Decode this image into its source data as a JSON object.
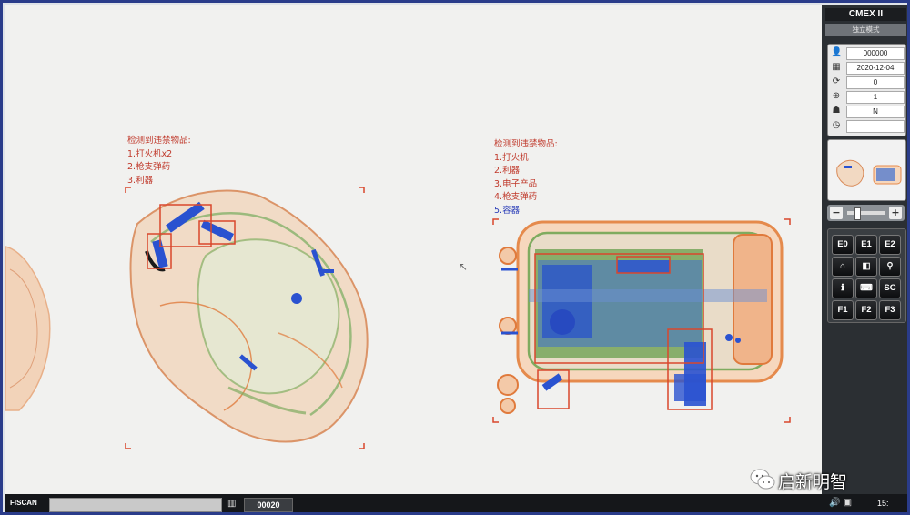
{
  "panel": {
    "brand": "CMEX II",
    "mode": "独立模式",
    "info": [
      {
        "icon": "user-icon",
        "value": "000000"
      },
      {
        "icon": "calendar-icon",
        "value": "2020-12-04"
      },
      {
        "icon": "counter-icon",
        "value": "0"
      },
      {
        "icon": "zoom-icon",
        "value": "1"
      },
      {
        "icon": "mode-icon",
        "value": "N"
      },
      {
        "icon": "clock-icon",
        "value": ""
      }
    ],
    "keys": [
      "E0",
      "E1",
      "E2",
      "",
      "",
      "",
      "",
      "",
      "SC",
      "F1",
      "F2",
      "F3"
    ]
  },
  "detections": {
    "left": {
      "heading": "检测到违禁物品:",
      "items": [
        "1.打火机x2",
        "2.枪支弹药",
        "3.利器"
      ]
    },
    "right": {
      "heading": "检测到违禁物品:",
      "items": [
        "1.打火机",
        "2.利器",
        "3.电子产品",
        "4.枪支弹药",
        "5.容器"
      ]
    }
  },
  "statusbar": {
    "brand": "FISCAN",
    "message": "",
    "counter": "00020",
    "clock": "15:"
  },
  "watermark": {
    "text": "启新明智"
  },
  "colors": {
    "detection_box": "#d9472c",
    "text_red": "#c0392b",
    "text_blue": "#2c3fb8",
    "xray_orange": "#e8945a",
    "xray_green": "#8fb86a",
    "xray_blue": "#2a52d0"
  }
}
